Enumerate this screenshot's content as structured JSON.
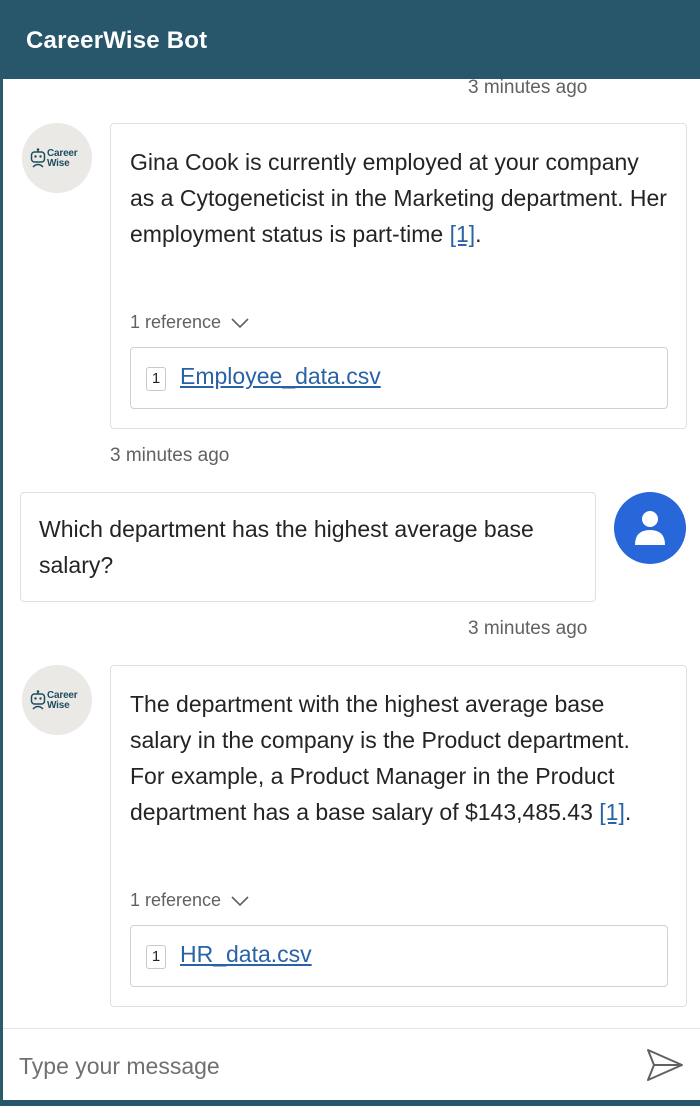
{
  "header": {
    "title": "CareerWise Bot"
  },
  "bot_avatar": {
    "logo_line1": "Career",
    "logo_line2": "Wise",
    "icon": "robot-icon"
  },
  "messages": [
    {
      "from": "bot",
      "top_timestamp": "3 minutes ago",
      "text": "Gina Cook is currently employed at your company as a Cytogeneticist in the Marketing department. Her employment status is part-time",
      "citation": "[1]",
      "after_citation": ".",
      "references_label": "1 reference",
      "reference": {
        "number": "1",
        "file": "Employee_data.csv"
      },
      "timestamp": "3 minutes ago"
    },
    {
      "from": "user",
      "text": "Which department has the highest average base salary?",
      "timestamp": "3 minutes ago",
      "avatar_icon": "user-icon"
    },
    {
      "from": "bot",
      "text": "The department with the highest average base salary in the company is the Product department. For example, a Product Manager in the Product department has a base salary of $143,485.43",
      "citation": "[1]",
      "after_citation": ".",
      "references_label": "1 reference",
      "reference": {
        "number": "1",
        "file": "HR_data.csv"
      }
    }
  ],
  "composer": {
    "placeholder": "Type your message",
    "send_icon": "send-icon"
  },
  "colors": {
    "header": "#28566a",
    "link": "#2962a6",
    "user_avatar": "#2767d9"
  }
}
